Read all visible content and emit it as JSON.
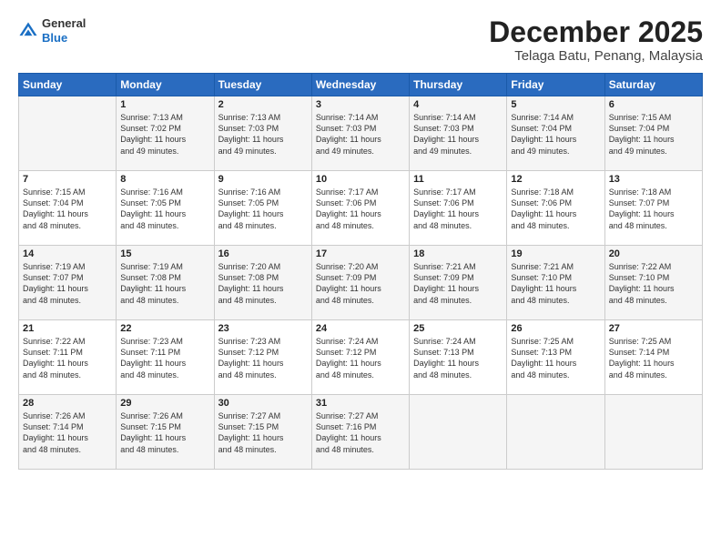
{
  "logo": {
    "general": "General",
    "blue": "Blue"
  },
  "title": "December 2025",
  "location": "Telaga Batu, Penang, Malaysia",
  "days_header": [
    "Sunday",
    "Monday",
    "Tuesday",
    "Wednesday",
    "Thursday",
    "Friday",
    "Saturday"
  ],
  "weeks": [
    [
      {
        "day": "",
        "info": ""
      },
      {
        "day": "1",
        "info": "Sunrise: 7:13 AM\nSunset: 7:02 PM\nDaylight: 11 hours\nand 49 minutes."
      },
      {
        "day": "2",
        "info": "Sunrise: 7:13 AM\nSunset: 7:03 PM\nDaylight: 11 hours\nand 49 minutes."
      },
      {
        "day": "3",
        "info": "Sunrise: 7:14 AM\nSunset: 7:03 PM\nDaylight: 11 hours\nand 49 minutes."
      },
      {
        "day": "4",
        "info": "Sunrise: 7:14 AM\nSunset: 7:03 PM\nDaylight: 11 hours\nand 49 minutes."
      },
      {
        "day": "5",
        "info": "Sunrise: 7:14 AM\nSunset: 7:04 PM\nDaylight: 11 hours\nand 49 minutes."
      },
      {
        "day": "6",
        "info": "Sunrise: 7:15 AM\nSunset: 7:04 PM\nDaylight: 11 hours\nand 49 minutes."
      }
    ],
    [
      {
        "day": "7",
        "info": "Sunrise: 7:15 AM\nSunset: 7:04 PM\nDaylight: 11 hours\nand 48 minutes."
      },
      {
        "day": "8",
        "info": "Sunrise: 7:16 AM\nSunset: 7:05 PM\nDaylight: 11 hours\nand 48 minutes."
      },
      {
        "day": "9",
        "info": "Sunrise: 7:16 AM\nSunset: 7:05 PM\nDaylight: 11 hours\nand 48 minutes."
      },
      {
        "day": "10",
        "info": "Sunrise: 7:17 AM\nSunset: 7:06 PM\nDaylight: 11 hours\nand 48 minutes."
      },
      {
        "day": "11",
        "info": "Sunrise: 7:17 AM\nSunset: 7:06 PM\nDaylight: 11 hours\nand 48 minutes."
      },
      {
        "day": "12",
        "info": "Sunrise: 7:18 AM\nSunset: 7:06 PM\nDaylight: 11 hours\nand 48 minutes."
      },
      {
        "day": "13",
        "info": "Sunrise: 7:18 AM\nSunset: 7:07 PM\nDaylight: 11 hours\nand 48 minutes."
      }
    ],
    [
      {
        "day": "14",
        "info": "Sunrise: 7:19 AM\nSunset: 7:07 PM\nDaylight: 11 hours\nand 48 minutes."
      },
      {
        "day": "15",
        "info": "Sunrise: 7:19 AM\nSunset: 7:08 PM\nDaylight: 11 hours\nand 48 minutes."
      },
      {
        "day": "16",
        "info": "Sunrise: 7:20 AM\nSunset: 7:08 PM\nDaylight: 11 hours\nand 48 minutes."
      },
      {
        "day": "17",
        "info": "Sunrise: 7:20 AM\nSunset: 7:09 PM\nDaylight: 11 hours\nand 48 minutes."
      },
      {
        "day": "18",
        "info": "Sunrise: 7:21 AM\nSunset: 7:09 PM\nDaylight: 11 hours\nand 48 minutes."
      },
      {
        "day": "19",
        "info": "Sunrise: 7:21 AM\nSunset: 7:10 PM\nDaylight: 11 hours\nand 48 minutes."
      },
      {
        "day": "20",
        "info": "Sunrise: 7:22 AM\nSunset: 7:10 PM\nDaylight: 11 hours\nand 48 minutes."
      }
    ],
    [
      {
        "day": "21",
        "info": "Sunrise: 7:22 AM\nSunset: 7:11 PM\nDaylight: 11 hours\nand 48 minutes."
      },
      {
        "day": "22",
        "info": "Sunrise: 7:23 AM\nSunset: 7:11 PM\nDaylight: 11 hours\nand 48 minutes."
      },
      {
        "day": "23",
        "info": "Sunrise: 7:23 AM\nSunset: 7:12 PM\nDaylight: 11 hours\nand 48 minutes."
      },
      {
        "day": "24",
        "info": "Sunrise: 7:24 AM\nSunset: 7:12 PM\nDaylight: 11 hours\nand 48 minutes."
      },
      {
        "day": "25",
        "info": "Sunrise: 7:24 AM\nSunset: 7:13 PM\nDaylight: 11 hours\nand 48 minutes."
      },
      {
        "day": "26",
        "info": "Sunrise: 7:25 AM\nSunset: 7:13 PM\nDaylight: 11 hours\nand 48 minutes."
      },
      {
        "day": "27",
        "info": "Sunrise: 7:25 AM\nSunset: 7:14 PM\nDaylight: 11 hours\nand 48 minutes."
      }
    ],
    [
      {
        "day": "28",
        "info": "Sunrise: 7:26 AM\nSunset: 7:14 PM\nDaylight: 11 hours\nand 48 minutes."
      },
      {
        "day": "29",
        "info": "Sunrise: 7:26 AM\nSunset: 7:15 PM\nDaylight: 11 hours\nand 48 minutes."
      },
      {
        "day": "30",
        "info": "Sunrise: 7:27 AM\nSunset: 7:15 PM\nDaylight: 11 hours\nand 48 minutes."
      },
      {
        "day": "31",
        "info": "Sunrise: 7:27 AM\nSunset: 7:16 PM\nDaylight: 11 hours\nand 48 minutes."
      },
      {
        "day": "",
        "info": ""
      },
      {
        "day": "",
        "info": ""
      },
      {
        "day": "",
        "info": ""
      }
    ]
  ]
}
